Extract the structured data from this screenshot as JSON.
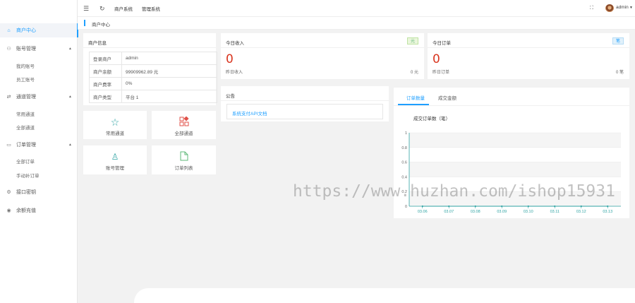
{
  "header": {
    "menu_icon": "menu-icon",
    "refresh_icon": "refresh-icon",
    "tabs": [
      "商户系统",
      "管理系统"
    ],
    "fullscreen_icon": "fullscreen-icon",
    "username": "admin"
  },
  "breadcrumb": "商户中心",
  "sidebar": {
    "items": [
      {
        "label": "商户中心",
        "icon": "home-icon",
        "active": true
      },
      {
        "label": "账号管理",
        "icon": "user-icon",
        "expandable": true
      },
      {
        "label": "我的账号"
      },
      {
        "label": "员工账号"
      },
      {
        "label": "通道管理",
        "icon": "channel-icon",
        "expandable": true
      },
      {
        "label": "常用通道"
      },
      {
        "label": "全部通道"
      },
      {
        "label": "订单管理",
        "icon": "order-icon",
        "expandable": true
      },
      {
        "label": "全部订单"
      },
      {
        "label": "手动补订单"
      },
      {
        "label": "接口密钥",
        "icon": "key-icon"
      },
      {
        "label": "余额充值",
        "icon": "wallet-icon"
      }
    ]
  },
  "merchant_info": {
    "title": "商户信息",
    "rows": [
      {
        "k": "登录商户",
        "v": "admin"
      },
      {
        "k": "商户余额",
        "v": "99909962.89 元"
      },
      {
        "k": "商户费率",
        "v": "0%"
      },
      {
        "k": "商户类型",
        "v": "平台 1"
      }
    ]
  },
  "today_income": {
    "title": "今日收入",
    "badge": "元",
    "value": "0",
    "sub_label": "昨日收入",
    "sub_value": "0 元"
  },
  "today_orders": {
    "title": "今日订单",
    "badge": "笔",
    "value": "0",
    "sub_label": "昨日订单",
    "sub_value": "0 笔"
  },
  "shortcuts": [
    {
      "label": "常用通道",
      "icon": "star-icon"
    },
    {
      "label": "全部通道",
      "icon": "grid-icon"
    },
    {
      "label": "账号管理",
      "icon": "user-outline-icon"
    },
    {
      "label": "订单列表",
      "icon": "file-icon"
    }
  ],
  "notice": {
    "title": "公告",
    "link": "系统支付API文档"
  },
  "chart_tabs": [
    "订单数量",
    "成交金额"
  ],
  "chart_data": {
    "type": "line",
    "title": "成交订单数（笔）",
    "x": [
      "03.06",
      "03.07",
      "03.08",
      "03.09",
      "03.10",
      "03.11",
      "03.12",
      "03.13"
    ],
    "series": [
      {
        "values": [
          0,
          0,
          0,
          0,
          0,
          0,
          0,
          0
        ]
      }
    ],
    "yticks": [
      "0",
      "0.2",
      "0.4",
      "0.6",
      "0.8",
      "1"
    ],
    "ylim": [
      0,
      1
    ],
    "color": "#2ea3a3"
  },
  "watermark": "https://www.huzhan.com/ishop15931"
}
